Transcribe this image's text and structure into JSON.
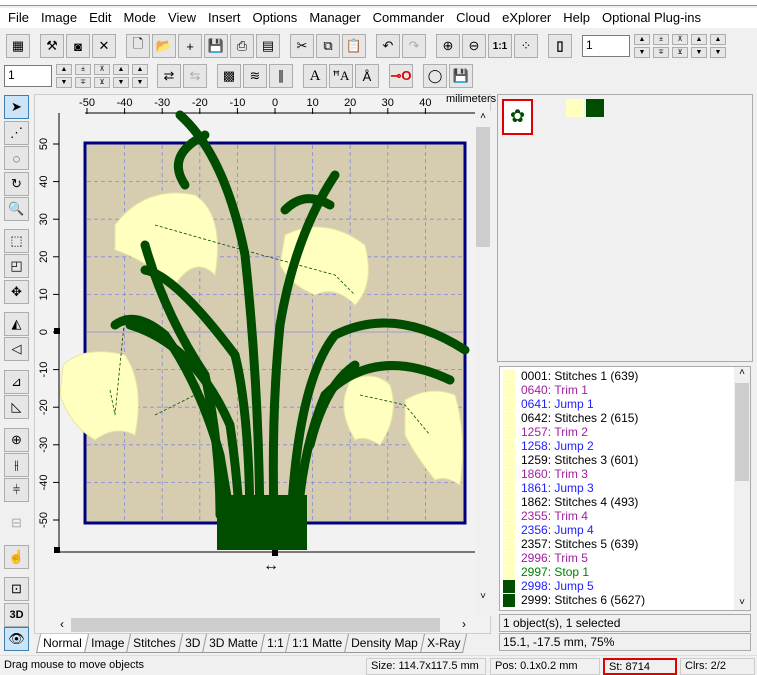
{
  "menu": [
    "File",
    "Image",
    "Edit",
    "Mode",
    "View",
    "Insert",
    "Options",
    "Manager",
    "Commander",
    "Cloud",
    "eXplorer",
    "Help",
    "Optional Plug-ins"
  ],
  "toolbar1": {
    "spin_value": "1"
  },
  "toolbar2": {
    "spin_value": "1"
  },
  "ruler": {
    "unit": "milimeters",
    "x_ticks": [
      "-50",
      "-40",
      "-30",
      "-20",
      "-10",
      "0",
      "10",
      "20",
      "30",
      "40"
    ],
    "y_ticks": [
      "50",
      "40",
      "30",
      "20",
      "10",
      "0",
      "-10",
      "-20",
      "-30",
      "-40",
      "-50"
    ]
  },
  "colors": {
    "yellow": "#ffffc0",
    "green": "#004d00",
    "design_bg": "#d6cdb0",
    "frame": "#000080"
  },
  "tabs": [
    "Normal",
    "Image",
    "Stitches",
    "3D",
    "3D Matte",
    "1:1",
    "1:1 Matte",
    "Density Map",
    "X-Ray"
  ],
  "active_tab": "Normal",
  "list": [
    {
      "num": "0001:",
      "label": "Stitches 1 (639)",
      "kind": "stitch",
      "color": "#ffffc0"
    },
    {
      "num": "0640:",
      "label": "Trim 1",
      "kind": "trim",
      "color": "#ffffc0"
    },
    {
      "num": "0641:",
      "label": "Jump 1",
      "kind": "jump",
      "color": "#ffffc0"
    },
    {
      "num": "0642:",
      "label": "Stitches 2 (615)",
      "kind": "stitch",
      "color": "#ffffc0"
    },
    {
      "num": "1257:",
      "label": "Trim 2",
      "kind": "trim",
      "color": "#ffffc0"
    },
    {
      "num": "1258:",
      "label": "Jump 2",
      "kind": "jump",
      "color": "#ffffc0"
    },
    {
      "num": "1259:",
      "label": "Stitches 3 (601)",
      "kind": "stitch",
      "color": "#ffffc0"
    },
    {
      "num": "1860:",
      "label": "Trim 3",
      "kind": "trim",
      "color": "#ffffc0"
    },
    {
      "num": "1861:",
      "label": "Jump 3",
      "kind": "jump",
      "color": "#ffffc0"
    },
    {
      "num": "1862:",
      "label": "Stitches 4 (493)",
      "kind": "stitch",
      "color": "#ffffc0"
    },
    {
      "num": "2355:",
      "label": "Trim 4",
      "kind": "trim",
      "color": "#ffffc0"
    },
    {
      "num": "2356:",
      "label": "Jump 4",
      "kind": "jump",
      "color": "#ffffc0"
    },
    {
      "num": "2357:",
      "label": "Stitches 5 (639)",
      "kind": "stitch",
      "color": "#ffffc0"
    },
    {
      "num": "2996:",
      "label": "Trim 5",
      "kind": "trim",
      "color": "#ffffc0"
    },
    {
      "num": "2997:",
      "label": "Stop 1",
      "kind": "stop",
      "color": "#ffffc0"
    },
    {
      "num": "2998:",
      "label": "Jump 5",
      "kind": "jump",
      "color": "#004d00"
    },
    {
      "num": "2999:",
      "label": "Stitches 6 (5627)",
      "kind": "stitch",
      "color": "#004d00"
    }
  ],
  "selection_info": "1 object(s), 1 selected",
  "position_info": "15.1, -17.5 mm, 75%",
  "status": {
    "hint": "Drag mouse to move objects",
    "size": "Size: 114.7x117.5 mm",
    "pos": "Pos: 0.1x0.2 mm",
    "stitches": "St: 8714",
    "colors": "Clrs: 2/2"
  }
}
